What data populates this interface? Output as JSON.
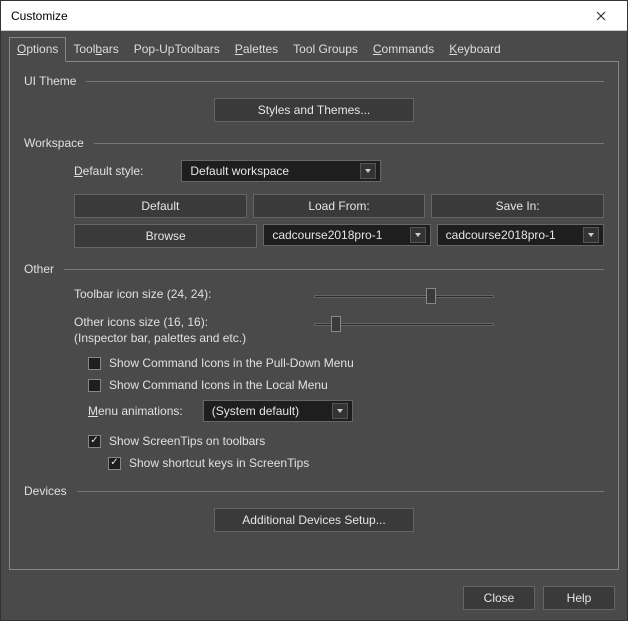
{
  "window": {
    "title": "Customize"
  },
  "tabs": [
    {
      "label": "Options",
      "key": "O"
    },
    {
      "label": "Toolbars",
      "key": "T"
    },
    {
      "label": "Pop-UpToolbars"
    },
    {
      "label": "Palettes",
      "key": "P"
    },
    {
      "label": "Tool Groups"
    },
    {
      "label": "Commands",
      "key": "C"
    },
    {
      "label": "Keyboard",
      "key": "K"
    }
  ],
  "sections": {
    "ui_theme": {
      "title": "UI Theme",
      "styles_btn": "Styles and Themes..."
    },
    "workspace": {
      "title": "Workspace",
      "default_style_label": "Default style:",
      "default_style_value": "Default workspace",
      "default_btn": "Default",
      "load_from_btn": "Load From:",
      "save_in_btn": "Save In:",
      "browse_btn": "Browse",
      "load_from_value": "cadcourse2018pro-1",
      "save_in_value": "cadcourse2018pro-1"
    },
    "other": {
      "title": "Other",
      "toolbar_icon_label": "Toolbar icon size (24, 24):",
      "other_icons_label_line1": "Other icons size (16, 16):",
      "other_icons_label_line2": "(Inspector bar, palettes and etc.)",
      "show_cmd_pulldown": "Show Command Icons in the Pull-Down Menu",
      "show_cmd_local": "Show Command Icons in the Local Menu",
      "menu_anim_label": "Menu animations:",
      "menu_anim_value": "(System default)",
      "show_screentips": "Show ScreenTips on toolbars",
      "show_shortcut_keys": "Show shortcut keys in ScreenTips"
    },
    "devices": {
      "title": "Devices",
      "additional_btn": "Additional Devices Setup..."
    }
  },
  "footer": {
    "close": "Close",
    "help": "Help"
  },
  "sliders": {
    "toolbar_pos_pct": 66,
    "other_pos_pct": 10
  }
}
